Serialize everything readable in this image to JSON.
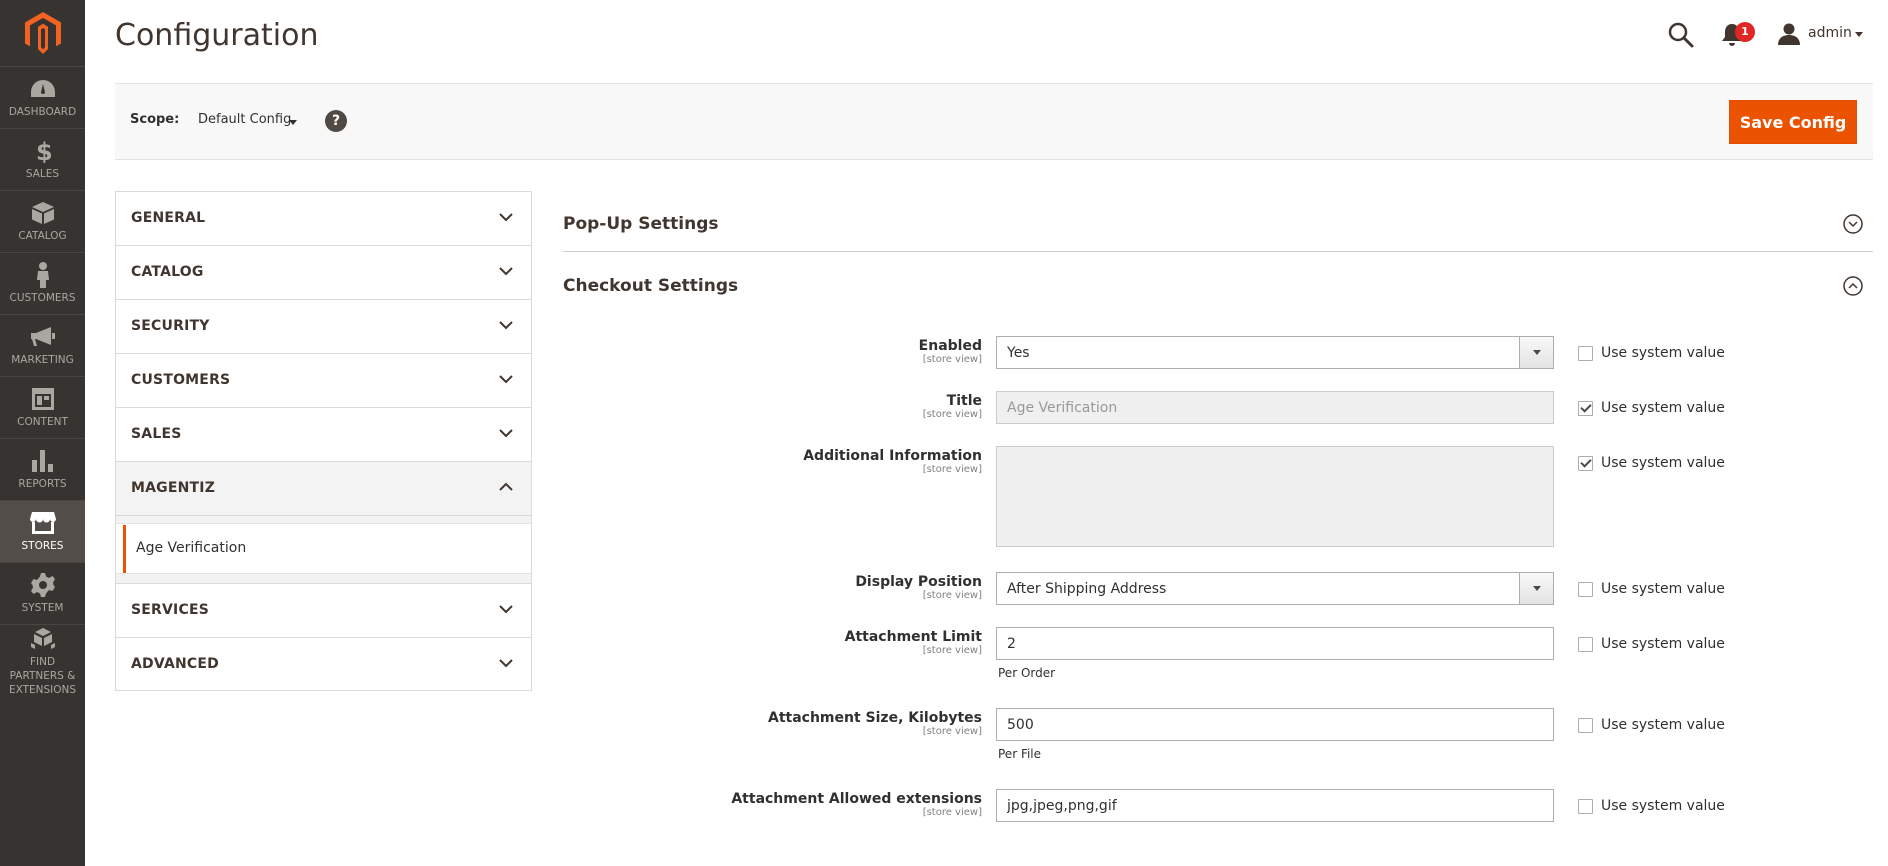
{
  "menu": {
    "items": [
      {
        "label": "DASHBOARD",
        "icon": "dashboard-icon"
      },
      {
        "label": "SALES",
        "icon": "dollar-icon"
      },
      {
        "label": "CATALOG",
        "icon": "box-icon"
      },
      {
        "label": "CUSTOMERS",
        "icon": "person-icon"
      },
      {
        "label": "MARKETING",
        "icon": "megaphone-icon"
      },
      {
        "label": "CONTENT",
        "icon": "layout-icon"
      },
      {
        "label": "REPORTS",
        "icon": "bar-chart-icon"
      },
      {
        "label": "STORES",
        "icon": "storefront-icon"
      },
      {
        "label": "SYSTEM",
        "icon": "gear-icon"
      },
      {
        "label": "FIND PARTNERS & EXTENSIONS",
        "icon": "cubes-icon"
      }
    ],
    "active": "STORES"
  },
  "header": {
    "title": "Configuration",
    "notifications_count": "1",
    "user": "admin"
  },
  "scope": {
    "label": "Scope:",
    "value": "Default Config",
    "help": "?",
    "save_label": "Save Config"
  },
  "tabs": {
    "items": [
      "GENERAL",
      "CATALOG",
      "SECURITY",
      "CUSTOMERS",
      "SALES",
      "MAGENTIZ",
      "SERVICES",
      "ADVANCED"
    ],
    "sub_item": "Age Verification"
  },
  "sections": {
    "popup": "Pop-Up Settings",
    "checkout": "Checkout Settings"
  },
  "fields": {
    "scope_text": "[store view]",
    "system_value_label": "Use system value",
    "enabled": {
      "label": "Enabled",
      "value": "Yes",
      "use_system": false
    },
    "title": {
      "label": "Title",
      "value": "Age Verification",
      "use_system": true
    },
    "additional_info": {
      "label": "Additional Information",
      "value": "",
      "use_system": true
    },
    "display_position": {
      "label": "Display Position",
      "value": "After Shipping Address",
      "use_system": false
    },
    "attachment_limit": {
      "label": "Attachment Limit",
      "value": "2",
      "note": "Per Order",
      "use_system": false
    },
    "attachment_size": {
      "label": "Attachment Size, Kilobytes",
      "value": "500",
      "note": "Per File",
      "use_system": false
    },
    "attachment_ext": {
      "label": "Attachment Allowed extensions",
      "value": "jpg,jpeg,png,gif",
      "use_system": false
    }
  },
  "colors": {
    "accent": "#eb5202",
    "menu_bg": "#373330",
    "menu_active": "#524d49"
  }
}
